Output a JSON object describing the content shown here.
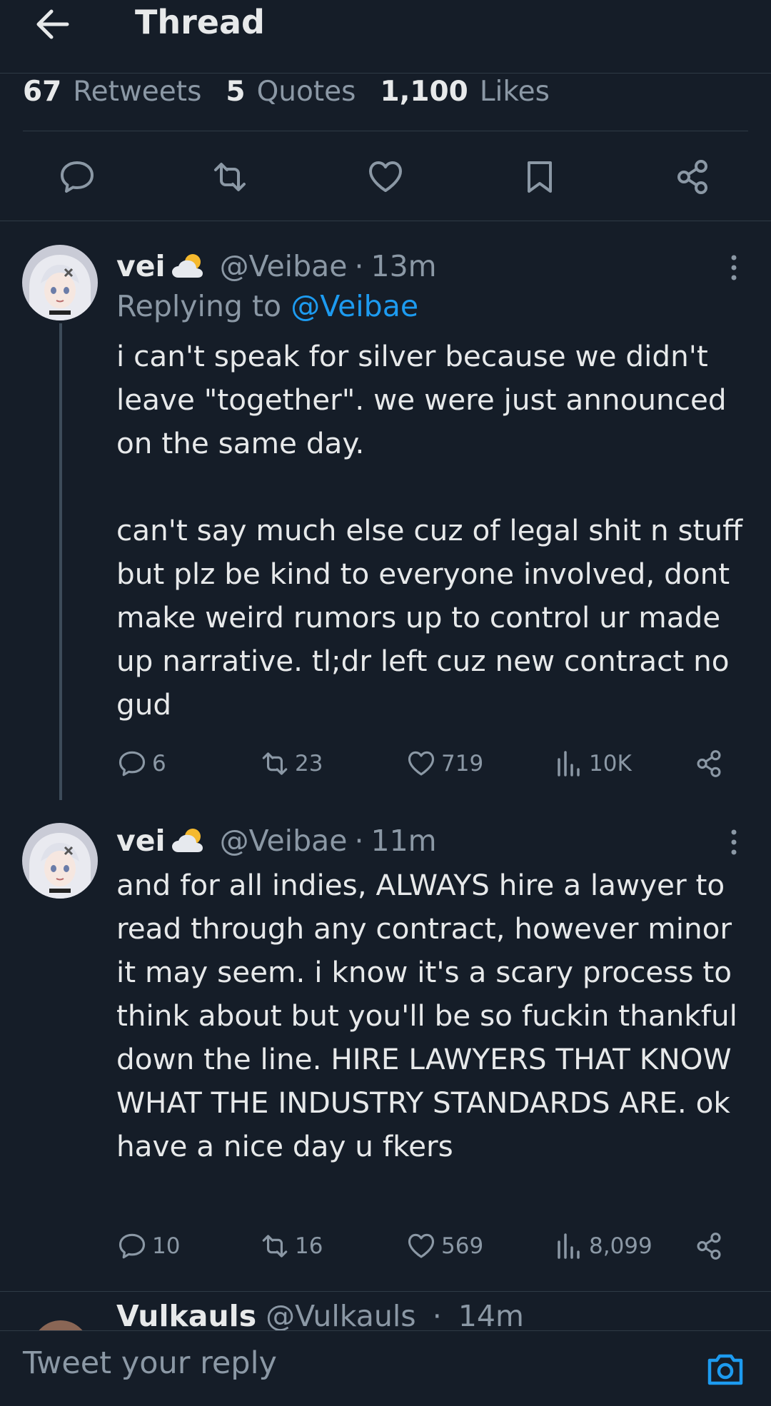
{
  "header": {
    "title": "Thread",
    "back_icon": "arrow-left-icon"
  },
  "stats": [
    {
      "num": "67",
      "label": "Retweets"
    },
    {
      "num": "5",
      "label": "Quotes"
    },
    {
      "num": "1,100",
      "label": "Likes"
    }
  ],
  "main_actions": [
    "reply-icon",
    "retweet-icon",
    "like-icon",
    "bookmark-icon",
    "share-icon"
  ],
  "tweets": [
    {
      "name": "vei",
      "handle": "@Veibae",
      "sep": "·",
      "time": "13m",
      "replying_prefix": "Replying to",
      "replying_handle": "@Veibae",
      "paragraphs": [
        "i can't speak for silver because we didn't leave \"together\". we were just announced on the same day.",
        "can't say much else cuz of legal shit n stuff but plz be kind to everyone involved, dont make weird rumors up to control ur made up narrative. tl;dr left cuz new contract no gud"
      ],
      "replies": "6",
      "retweets": "23",
      "likes": "719",
      "views": "10K"
    },
    {
      "name": "vei",
      "handle": "@Veibae",
      "sep": "·",
      "time": "11m",
      "paragraphs": [
        "and for all indies, ALWAYS hire a lawyer to read through any contract, however minor it may seem. i know it's a scary process to think about but you'll be so fuckin thankful down the line. HIRE LAWYERS THAT KNOW WHAT THE INDUSTRY STANDARDS ARE. ok have a nice day u fkers"
      ],
      "replies": "10",
      "retweets": "16",
      "likes": "569",
      "views": "8,099"
    }
  ],
  "next_tweet_peek": {
    "name": "Vulkauls",
    "handle": "@Vulkauls",
    "sep": "·",
    "time": "14m"
  },
  "reply_bar": {
    "placeholder": "Tweet your reply",
    "camera_icon": "camera-icon"
  },
  "colors": {
    "background": "#151d28",
    "text": "#e7e9ea",
    "muted": "#8b98a5",
    "accent": "#1d9bf0",
    "divider": "#2f3a46"
  }
}
